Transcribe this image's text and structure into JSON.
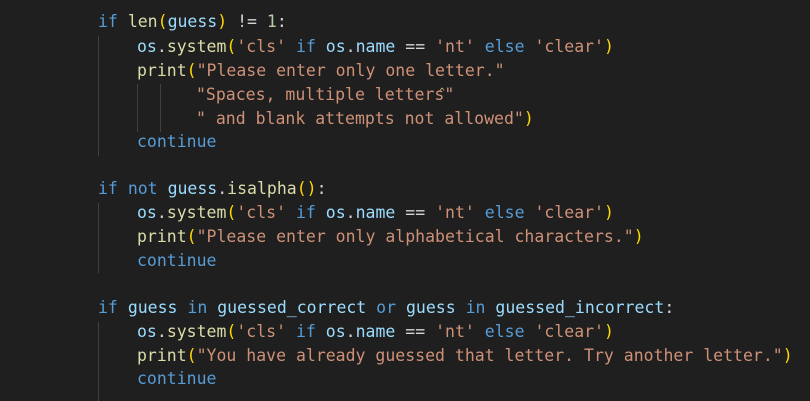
{
  "editor": {
    "lines": [
      {
        "id": "l1",
        "indent": 1,
        "tokens": [
          {
            "t": "if ",
            "c": "kw"
          },
          {
            "t": "len",
            "c": "fn"
          },
          {
            "t": "(",
            "c": "p1"
          },
          {
            "t": "guess",
            "c": "var"
          },
          {
            "t": ")",
            "c": "p1"
          },
          {
            "t": " != ",
            "c": "op"
          },
          {
            "t": "1",
            "c": "num"
          },
          {
            "t": ":",
            "c": "op"
          }
        ]
      },
      {
        "id": "l2",
        "indent": 2,
        "tokens": [
          {
            "t": "os",
            "c": "var"
          },
          {
            "t": ".",
            "c": "op"
          },
          {
            "t": "system",
            "c": "fn"
          },
          {
            "t": "(",
            "c": "p1"
          },
          {
            "t": "'cls'",
            "c": "str"
          },
          {
            "t": " if ",
            "c": "kw"
          },
          {
            "t": "os",
            "c": "var"
          },
          {
            "t": ".",
            "c": "op"
          },
          {
            "t": "name",
            "c": "var"
          },
          {
            "t": " == ",
            "c": "op"
          },
          {
            "t": "'nt'",
            "c": "str"
          },
          {
            "t": " else ",
            "c": "kw"
          },
          {
            "t": "'clear'",
            "c": "str"
          },
          {
            "t": ")",
            "c": "p1"
          }
        ]
      },
      {
        "id": "l3",
        "indent": 2,
        "tokens": [
          {
            "t": "print",
            "c": "fn"
          },
          {
            "t": "(",
            "c": "p1"
          },
          {
            "t": "\"Please enter only one letter.\"",
            "c": "str"
          }
        ]
      },
      {
        "id": "l4",
        "indent": 4,
        "tokens": [
          {
            "t": "\"Spaces, multiple letters\"",
            "c": "str"
          }
        ]
      },
      {
        "id": "l5",
        "indent": 4,
        "tokens": [
          {
            "t": "\" and blank attempts not allowed\"",
            "c": "str"
          },
          {
            "t": ")",
            "c": "p1"
          }
        ]
      },
      {
        "id": "l6",
        "indent": 2,
        "tokens": [
          {
            "t": "continue",
            "c": "kw"
          }
        ]
      },
      {
        "id": "l7",
        "indent": 0,
        "tokens": []
      },
      {
        "id": "l8",
        "indent": 1,
        "tokens": [
          {
            "t": "if ",
            "c": "kw"
          },
          {
            "t": "not ",
            "c": "kw"
          },
          {
            "t": "guess",
            "c": "var"
          },
          {
            "t": ".",
            "c": "op"
          },
          {
            "t": "isalpha",
            "c": "fn"
          },
          {
            "t": "(",
            "c": "p1"
          },
          {
            "t": ")",
            "c": "p1"
          },
          {
            "t": ":",
            "c": "op"
          }
        ]
      },
      {
        "id": "l9",
        "indent": 2,
        "tokens": [
          {
            "t": "os",
            "c": "var"
          },
          {
            "t": ".",
            "c": "op"
          },
          {
            "t": "system",
            "c": "fn"
          },
          {
            "t": "(",
            "c": "p1"
          },
          {
            "t": "'cls'",
            "c": "str"
          },
          {
            "t": " if ",
            "c": "kw"
          },
          {
            "t": "os",
            "c": "var"
          },
          {
            "t": ".",
            "c": "op"
          },
          {
            "t": "name",
            "c": "var"
          },
          {
            "t": " == ",
            "c": "op"
          },
          {
            "t": "'nt'",
            "c": "str"
          },
          {
            "t": " else ",
            "c": "kw"
          },
          {
            "t": "'clear'",
            "c": "str"
          },
          {
            "t": ")",
            "c": "p1"
          }
        ]
      },
      {
        "id": "l10",
        "indent": 2,
        "tokens": [
          {
            "t": "print",
            "c": "fn"
          },
          {
            "t": "(",
            "c": "p1"
          },
          {
            "t": "\"Please enter only alphabetical characters.\"",
            "c": "str"
          },
          {
            "t": ")",
            "c": "p1"
          }
        ]
      },
      {
        "id": "l11",
        "indent": 2,
        "tokens": [
          {
            "t": "continue",
            "c": "kw"
          }
        ]
      },
      {
        "id": "l12",
        "indent": 0,
        "tokens": []
      },
      {
        "id": "l13",
        "indent": 1,
        "tokens": [
          {
            "t": "if ",
            "c": "kw"
          },
          {
            "t": "guess",
            "c": "var"
          },
          {
            "t": " in ",
            "c": "kw"
          },
          {
            "t": "guessed_correct",
            "c": "var"
          },
          {
            "t": " or ",
            "c": "kw"
          },
          {
            "t": "guess",
            "c": "var"
          },
          {
            "t": " in ",
            "c": "kw"
          },
          {
            "t": "guessed_incorrect",
            "c": "var"
          },
          {
            "t": ":",
            "c": "op"
          }
        ]
      },
      {
        "id": "l14",
        "indent": 2,
        "tokens": [
          {
            "t": "os",
            "c": "var"
          },
          {
            "t": ".",
            "c": "op"
          },
          {
            "t": "system",
            "c": "fn"
          },
          {
            "t": "(",
            "c": "p1"
          },
          {
            "t": "'cls'",
            "c": "str"
          },
          {
            "t": " if ",
            "c": "kw"
          },
          {
            "t": "os",
            "c": "var"
          },
          {
            "t": ".",
            "c": "op"
          },
          {
            "t": "name",
            "c": "var"
          },
          {
            "t": " == ",
            "c": "op"
          },
          {
            "t": "'nt'",
            "c": "str"
          },
          {
            "t": " else ",
            "c": "kw"
          },
          {
            "t": "'clear'",
            "c": "str"
          },
          {
            "t": ")",
            "c": "p1"
          }
        ]
      },
      {
        "id": "l15",
        "indent": 2,
        "tokens": [
          {
            "t": "print",
            "c": "fn"
          },
          {
            "t": "(",
            "c": "p1"
          },
          {
            "t": "\"You have already guessed that letter. Try another letter.\"",
            "c": "str"
          },
          {
            "t": ")",
            "c": "p1"
          }
        ]
      },
      {
        "id": "l16",
        "indent": 2,
        "tokens": [
          {
            "t": "continue",
            "c": "kw"
          }
        ]
      }
    ]
  },
  "colors": {
    "background": "#1f1f1f",
    "keyword": "#569cd6",
    "function": "#dcdcaa",
    "variable": "#9cdcfe",
    "string": "#ce9178",
    "number": "#b5cea8",
    "bracket": "#ffd700",
    "indent_guide": "#404040"
  }
}
